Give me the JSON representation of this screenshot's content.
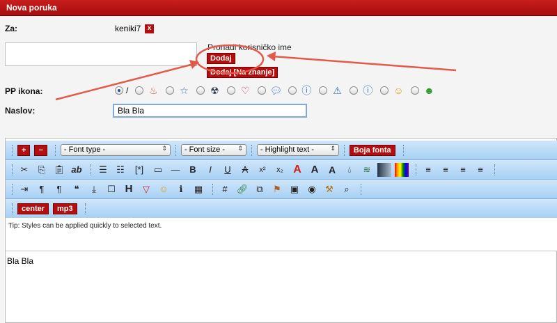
{
  "header": {
    "title": "Nova poruka"
  },
  "form": {
    "to_label": "Za:",
    "recipient": "keniki7",
    "remove_label": "x",
    "find_label": "Pronađi korisničko ime",
    "add_label": "Dodaj",
    "add_cc_label": "Dodaj [Na znanje]",
    "icon_label": "PP ikona:",
    "no_icon": "/",
    "subject_label": "Naslov:",
    "subject_value": "Bla Bla"
  },
  "editor": {
    "plus": "+",
    "minus": "−",
    "font_type": "- Font type -",
    "font_size": "- Font size -",
    "highlight": "- Highlight text -",
    "font_color": "Boja fonta",
    "center_label": "center",
    "mp3_label": "mp3",
    "tip": "Tip: Styles can be applied quickly to selected text.",
    "body": "Bla Bla",
    "format_labels": {
      "ab": "ab",
      "code": "[*]",
      "bold": "B",
      "italic": "I",
      "underline": "U",
      "strike": "A",
      "sup": "x²",
      "sub": "x₂",
      "fontA": "A",
      "fontA2": "A",
      "fontA3": "A",
      "heading": "H"
    }
  },
  "colors": {
    "header_red": "#b50e0e",
    "toolbar_blue": "#a8d0f3",
    "annotation": "#e25b4a"
  }
}
